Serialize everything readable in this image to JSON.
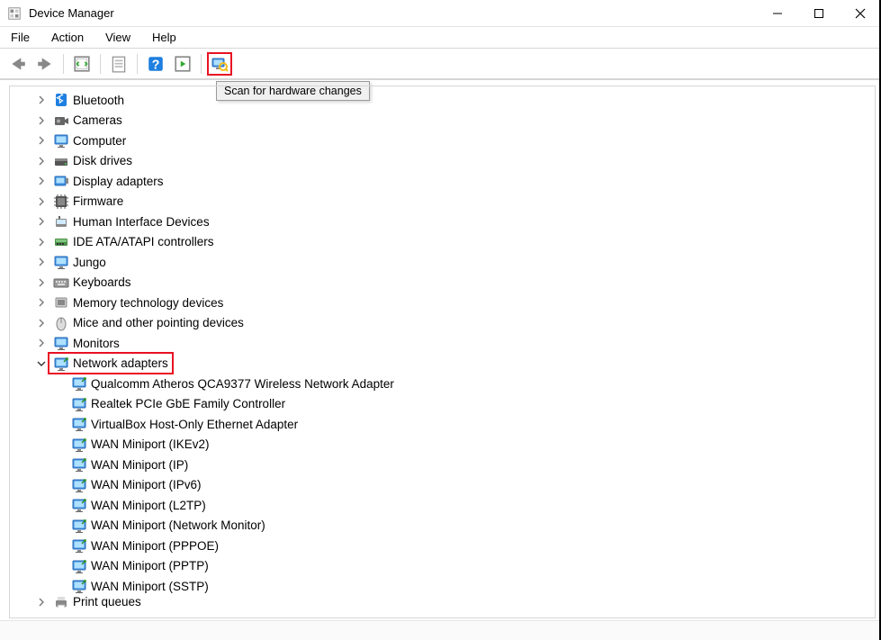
{
  "window": {
    "title": "Device Manager"
  },
  "menu": {
    "items": [
      "File",
      "Action",
      "View",
      "Help"
    ]
  },
  "toolbar": {
    "tooltip": "Scan for hardware changes"
  },
  "tree": {
    "nodes": [
      {
        "label": "Bluetooth",
        "level": 1,
        "expanded": false,
        "icon": "bluetooth-icon"
      },
      {
        "label": "Cameras",
        "level": 1,
        "expanded": false,
        "icon": "camera-icon"
      },
      {
        "label": "Computer",
        "level": 1,
        "expanded": false,
        "icon": "monitor-icon"
      },
      {
        "label": "Disk drives",
        "level": 1,
        "expanded": false,
        "icon": "disk-icon"
      },
      {
        "label": "Display adapters",
        "level": 1,
        "expanded": false,
        "icon": "display-adapter-icon"
      },
      {
        "label": "Firmware",
        "level": 1,
        "expanded": false,
        "icon": "firmware-icon"
      },
      {
        "label": "Human Interface Devices",
        "level": 1,
        "expanded": false,
        "icon": "hid-icon"
      },
      {
        "label": "IDE ATA/ATAPI controllers",
        "level": 1,
        "expanded": false,
        "icon": "ide-icon"
      },
      {
        "label": "Jungo",
        "level": 1,
        "expanded": false,
        "icon": "monitor-icon"
      },
      {
        "label": "Keyboards",
        "level": 1,
        "expanded": false,
        "icon": "keyboard-icon"
      },
      {
        "label": "Memory technology devices",
        "level": 1,
        "expanded": false,
        "icon": "memory-icon"
      },
      {
        "label": "Mice and other pointing devices",
        "level": 1,
        "expanded": false,
        "icon": "mouse-icon"
      },
      {
        "label": "Monitors",
        "level": 1,
        "expanded": false,
        "icon": "monitor-icon"
      },
      {
        "label": "Network adapters",
        "level": 1,
        "expanded": true,
        "icon": "network-icon",
        "highlight": true
      },
      {
        "label": "Qualcomm Atheros QCA9377 Wireless Network Adapter",
        "level": 2,
        "icon": "network-icon"
      },
      {
        "label": "Realtek PCIe GbE Family Controller",
        "level": 2,
        "icon": "network-icon"
      },
      {
        "label": "VirtualBox Host-Only Ethernet Adapter",
        "level": 2,
        "icon": "network-icon"
      },
      {
        "label": "WAN Miniport (IKEv2)",
        "level": 2,
        "icon": "network-icon"
      },
      {
        "label": "WAN Miniport (IP)",
        "level": 2,
        "icon": "network-icon"
      },
      {
        "label": "WAN Miniport (IPv6)",
        "level": 2,
        "icon": "network-icon"
      },
      {
        "label": "WAN Miniport (L2TP)",
        "level": 2,
        "icon": "network-icon"
      },
      {
        "label": "WAN Miniport (Network Monitor)",
        "level": 2,
        "icon": "network-icon"
      },
      {
        "label": "WAN Miniport (PPPOE)",
        "level": 2,
        "icon": "network-icon"
      },
      {
        "label": "WAN Miniport (PPTP)",
        "level": 2,
        "icon": "network-icon"
      },
      {
        "label": "WAN Miniport (SSTP)",
        "level": 2,
        "icon": "network-icon"
      },
      {
        "label": "Print queues",
        "level": 1,
        "expanded": false,
        "icon": "printer-icon",
        "cutoff": true
      }
    ]
  }
}
